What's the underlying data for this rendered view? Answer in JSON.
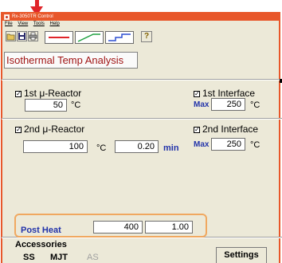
{
  "window": {
    "title": "Rx-3050TR Control"
  },
  "menu": [
    "File",
    "View",
    "Tools",
    "Help"
  ],
  "toolbar": {
    "open_icon": "folder-open-icon",
    "save_icon": "save-icon",
    "print_icon": "print-icon",
    "help_icon": "help-icon",
    "modes": [
      "isothermal-mode-icon",
      "ramp-mode-icon",
      "step-mode-icon"
    ],
    "help_glyph": "?"
  },
  "analysis_title": "Isothermal Temp Analysis",
  "reactor1": {
    "label": "1st μ-Reactor",
    "temp": "50",
    "unit": "°C",
    "interface_label": "1st Interface",
    "interface_max_label": "Max",
    "interface_temp": "250",
    "interface_unit": "°C"
  },
  "reactor2": {
    "label": "2nd μ-Reactor",
    "temp": "100",
    "unit": "°C",
    "time": "0.20",
    "time_unit": "min",
    "interface_label": "2nd Interface",
    "interface_max_label": "Max",
    "interface_temp": "250",
    "interface_unit": "°C"
  },
  "post_heat": {
    "label": "Post Heat",
    "temp": "400",
    "time": "1.00"
  },
  "accessories": {
    "label": "Accessories",
    "items": [
      "SS",
      "MJT",
      "AS"
    ]
  },
  "settings_label": "Settings",
  "colors": {
    "title_bar": "#e8572a",
    "arrow": "#e0252a",
    "accent_text": "#2233aa",
    "title_text": "#a01515",
    "highlight_box": "#f0a860"
  }
}
